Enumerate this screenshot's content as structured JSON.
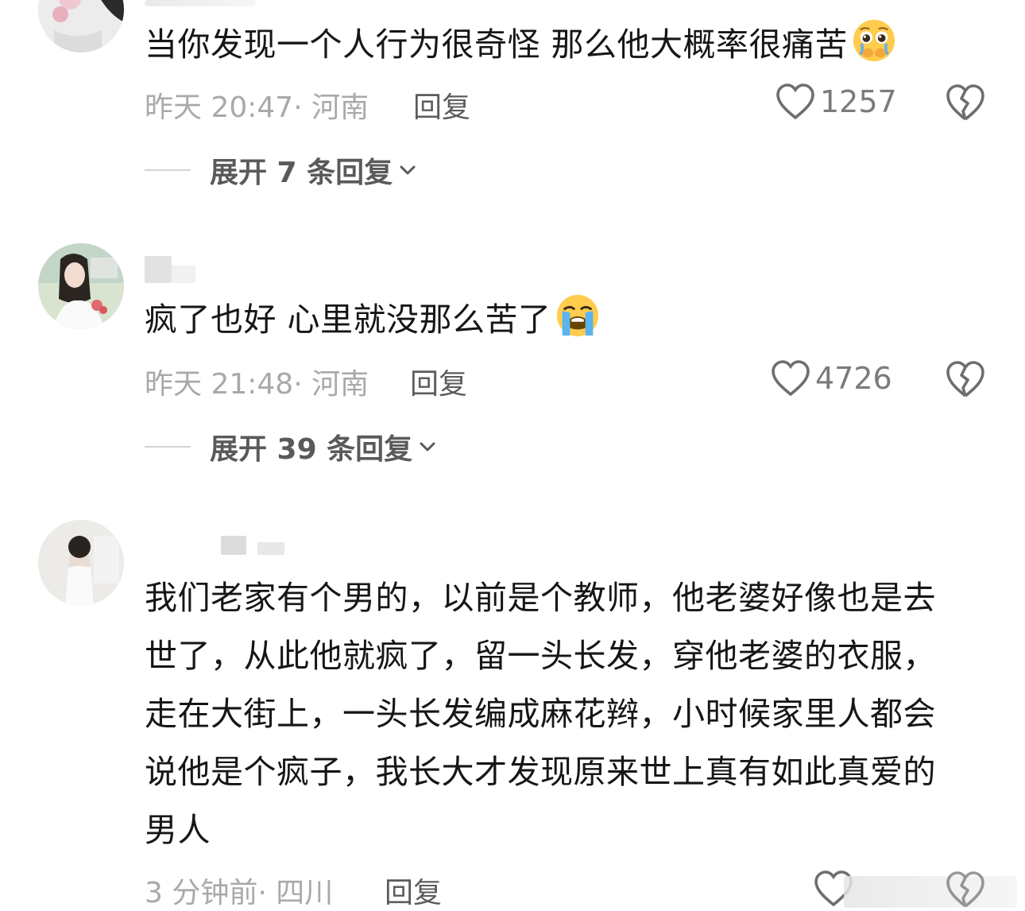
{
  "comments": [
    {
      "text": "当你发现一个人行为很奇怪 那么他大概率很痛苦",
      "emoji": "pleading-crying-face",
      "time": "昨天 20:47",
      "location": "· 河南",
      "reply_label": "回复",
      "likes": "1257",
      "expand_label": "展开 7 条回复"
    },
    {
      "text": "疯了也好 心里就没那么苦了",
      "emoji": "loudly-crying-face",
      "time": "昨天 21:48",
      "location": "· 河南",
      "reply_label": "回复",
      "likes": "4726",
      "expand_label": "展开 39 条回复"
    },
    {
      "text_lines": [
        "我们老家有个男的，以前是个教师，他老婆好像也是去",
        "世了，从此他就疯了，留一头长发，穿他老婆的衣服，",
        "走在大街上，一头长发编成麻花辫，小时候家里人都会",
        "说他是个疯子，我长大才发现原来世上真有如此真爱的",
        "男人"
      ],
      "time": "3 分钟前",
      "location": "· 四川",
      "reply_label": "回复"
    }
  ],
  "icons": {
    "like": "heart-outline-icon",
    "dislike": "broken-heart-icon",
    "expand": "chevron-down-icon"
  },
  "colors": {
    "text": "#161616",
    "meta": "#a9a9a9",
    "reply": "#5c5c5c",
    "like_count": "#7b7b7b"
  }
}
